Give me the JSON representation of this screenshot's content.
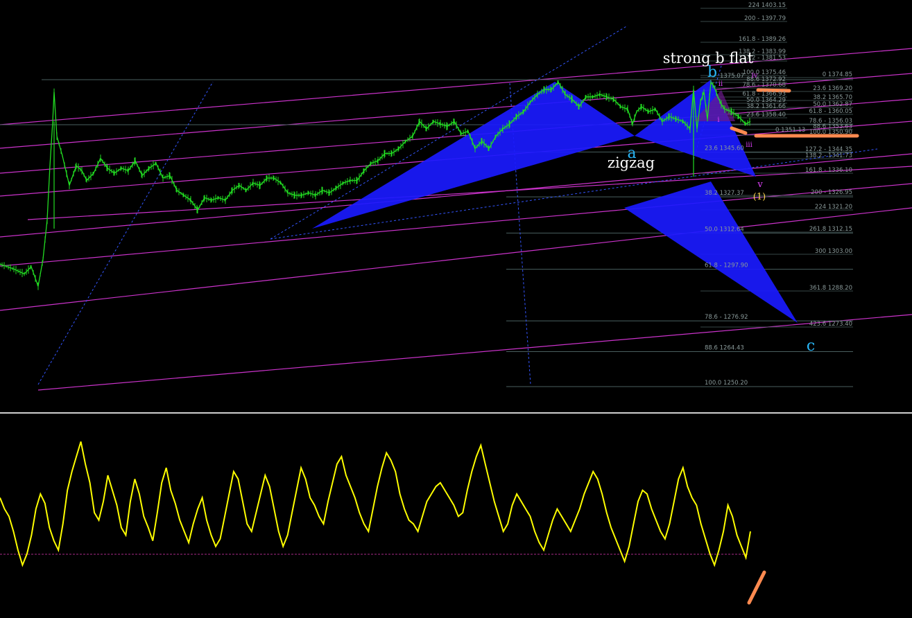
{
  "chart_data": [
    {
      "type": "line",
      "panel": "price",
      "description_of_scale": "price axis, labels printed only via fibonacci levels",
      "ylim": [
        1245,
        1406
      ],
      "colors": {
        "price_bars": "#22dd22",
        "channel_lines": "#cc33cc",
        "fib_lines": "#4a5f5f",
        "harmonic_fill": "#1a1aff",
        "trend_dotted": "#3355ff",
        "wave_label_cyan": "#29b6f6",
        "wave_label_magenta": "#e040fb",
        "wave_label_yellow": "#ffd54f",
        "highlight": "#ff8a50"
      },
      "price_path": [
        [
          0,
          1300
        ],
        [
          20,
          1298
        ],
        [
          35,
          1296
        ],
        [
          45,
          1299
        ],
        [
          55,
          1291
        ],
        [
          62,
          1302
        ],
        [
          68,
          1318
        ],
        [
          72,
          1340
        ],
        [
          76,
          1358
        ],
        [
          78,
          1370
        ],
        [
          82,
          1352
        ],
        [
          90,
          1344
        ],
        [
          100,
          1332
        ],
        [
          110,
          1340
        ],
        [
          118,
          1338
        ],
        [
          125,
          1334
        ],
        [
          135,
          1337
        ],
        [
          145,
          1343
        ],
        [
          155,
          1339
        ],
        [
          165,
          1337
        ],
        [
          175,
          1339
        ],
        [
          185,
          1338
        ],
        [
          195,
          1342
        ],
        [
          205,
          1336
        ],
        [
          215,
          1339
        ],
        [
          225,
          1341
        ],
        [
          235,
          1335
        ],
        [
          245,
          1336
        ],
        [
          255,
          1330
        ],
        [
          265,
          1328
        ],
        [
          275,
          1326
        ],
        [
          285,
          1322
        ],
        [
          295,
          1327
        ],
        [
          305,
          1326
        ],
        [
          315,
          1327
        ],
        [
          325,
          1326
        ],
        [
          335,
          1330
        ],
        [
          345,
          1332
        ],
        [
          355,
          1330
        ],
        [
          365,
          1333
        ],
        [
          375,
          1332
        ],
        [
          385,
          1335
        ],
        [
          395,
          1335
        ],
        [
          405,
          1333
        ],
        [
          415,
          1329
        ],
        [
          425,
          1328
        ],
        [
          435,
          1328
        ],
        [
          445,
          1329
        ],
        [
          455,
          1328
        ],
        [
          465,
          1330
        ],
        [
          475,
          1329
        ],
        [
          485,
          1331
        ],
        [
          495,
          1333
        ],
        [
          505,
          1334
        ],
        [
          515,
          1334
        ],
        [
          525,
          1338
        ],
        [
          535,
          1341
        ],
        [
          545,
          1342
        ],
        [
          555,
          1345
        ],
        [
          565,
          1345
        ],
        [
          575,
          1347
        ],
        [
          585,
          1350
        ],
        [
          595,
          1352
        ],
        [
          605,
          1358
        ],
        [
          615,
          1355
        ],
        [
          625,
          1358
        ],
        [
          635,
          1357
        ],
        [
          645,
          1356
        ],
        [
          655,
          1358
        ],
        [
          665,
          1353
        ],
        [
          675,
          1354
        ],
        [
          685,
          1347
        ],
        [
          695,
          1350
        ],
        [
          705,
          1347
        ],
        [
          715,
          1352
        ],
        [
          725,
          1355
        ],
        [
          735,
          1357
        ],
        [
          745,
          1360
        ],
        [
          755,
          1362
        ],
        [
          765,
          1366
        ],
        [
          775,
          1369
        ],
        [
          785,
          1371
        ],
        [
          795,
          1371
        ],
        [
          805,
          1374
        ],
        [
          815,
          1369
        ],
        [
          825,
          1367
        ],
        [
          835,
          1364
        ],
        [
          845,
          1368
        ],
        [
          855,
          1368
        ],
        [
          865,
          1369
        ],
        [
          875,
          1368
        ],
        [
          885,
          1367
        ],
        [
          895,
          1364
        ],
        [
          905,
          1363
        ],
        [
          912,
          1357
        ],
        [
          918,
          1362
        ],
        [
          925,
          1364
        ],
        [
          935,
          1362
        ],
        [
          945,
          1363
        ],
        [
          955,
          1358
        ],
        [
          965,
          1360
        ],
        [
          975,
          1359
        ],
        [
          985,
          1358
        ],
        [
          995,
          1355
        ],
        [
          1000,
          1371
        ],
        [
          1005,
          1355
        ],
        [
          1010,
          1366
        ],
        [
          1015,
          1370
        ],
        [
          1020,
          1359
        ],
        [
          1025,
          1374
        ],
        [
          1030,
          1372
        ],
        [
          1035,
          1368
        ],
        [
          1040,
          1365
        ],
        [
          1045,
          1363
        ],
        [
          1055,
          1362
        ],
        [
          1065,
          1360
        ],
        [
          1075,
          1357
        ],
        [
          1082,
          1358
        ]
      ],
      "fib_levels_left": [
        {
          "label": "23.6 1345.60"
        },
        {
          "label": "38.2 1327.37"
        },
        {
          "label": "50.0 1312.64"
        },
        {
          "label": "61.8 - 1297.90"
        },
        {
          "label": "78.6 - 1276.92"
        },
        {
          "label": "88.6 1264.43"
        },
        {
          "label": "100.0 1250.20"
        }
      ],
      "fib_levels_upper": [
        {
          "label": "224 1403.15"
        },
        {
          "label": "200 - 1397.79"
        },
        {
          "label": "161.8 - 1389.26"
        },
        {
          "label": "138.2 - 1383.99"
        },
        {
          "label": "127.2 - 1381.53"
        },
        {
          "label": "100.0 1375.46"
        },
        {
          "label": "88.6 1372.92"
        },
        {
          "label": "78.6 - 1370.68"
        },
        {
          "label": "61.8 - 1366.93"
        },
        {
          "label": "50.0 1364.29"
        },
        {
          "label": "38.2 1361.66"
        },
        {
          "label": "23.6 1358.40"
        }
      ],
      "fib_levels_right": [
        {
          "label": "0 1374.85"
        },
        {
          "label": "23.6 1369.20"
        },
        {
          "label": "38.2 1365.70"
        },
        {
          "label": "50.0 1362.87"
        },
        {
          "label": "61.8 - 1360.05"
        },
        {
          "label": "78.6 - 1356.03"
        },
        {
          "label": "88.6 1353.63"
        },
        {
          "label": "100.0 1350.90"
        },
        {
          "label": "127.2 - 1344.35"
        },
        {
          "label": "138.2 - 1341.73"
        },
        {
          "label": "161.8 - 1336.10"
        },
        {
          "label": "200 - 1326.95"
        },
        {
          "label": "224 1321.20"
        },
        {
          "label": "261.8 1312.15"
        },
        {
          "label": "300 1303.00"
        },
        {
          "label": "361.8 1288.20"
        },
        {
          "label": "423.6 1273.40"
        }
      ],
      "other_labels": [
        "1375.07",
        "0 1351.13"
      ],
      "annotations": {
        "strong_b_flat": "strong b flat",
        "zigzag": "zigzag",
        "wave_a": "a",
        "wave_b": "b",
        "wave_c": "c",
        "wave_i": "i",
        "wave_ii": "ii",
        "wave_iii": "iii",
        "wave_iv": "iv",
        "wave_v": "v",
        "wave_1": "(1)"
      }
    },
    {
      "type": "line",
      "panel": "oscillator",
      "color": "#ffff00",
      "ylim": [
        0,
        100
      ],
      "zero_line_color": "#aa2a8a",
      "series": [
        {
          "values": [
            58,
            52,
            48,
            40,
            30,
            22,
            28,
            38,
            52,
            60,
            55,
            42,
            35,
            30,
            44,
            62,
            72,
            80,
            88,
            76,
            66,
            50,
            46,
            56,
            70,
            62,
            54,
            42,
            38,
            56,
            68,
            60,
            48,
            42,
            35,
            50,
            66,
            74,
            62,
            55,
            46,
            40,
            34,
            44,
            52,
            58,
            46,
            38,
            32,
            36,
            48,
            60,
            72,
            68,
            56,
            44,
            40,
            50,
            60,
            70,
            64,
            52,
            40,
            32,
            38,
            50,
            62,
            74,
            68,
            58,
            54,
            48,
            44,
            56,
            66,
            76,
            80,
            70,
            64,
            58,
            50,
            44,
            40,
            52,
            64,
            74,
            82,
            78,
            72,
            60,
            52,
            46,
            44,
            40,
            48,
            56,
            60,
            64,
            66,
            62,
            58,
            54,
            48,
            50,
            62,
            72,
            80,
            86,
            76,
            66,
            56,
            48,
            40,
            44,
            54,
            60,
            56,
            52,
            48,
            40,
            34,
            30,
            38,
            46,
            52,
            48,
            44,
            40,
            46,
            52,
            60,
            66,
            72,
            68,
            60,
            50,
            42,
            36,
            30,
            24,
            32,
            44,
            56,
            62,
            60,
            52,
            46,
            40,
            36,
            44,
            56,
            68,
            74,
            64,
            58,
            54,
            44,
            36,
            28,
            22,
            30,
            40,
            54,
            48,
            38,
            32,
            26,
            40
          ]
        }
      ]
    }
  ]
}
